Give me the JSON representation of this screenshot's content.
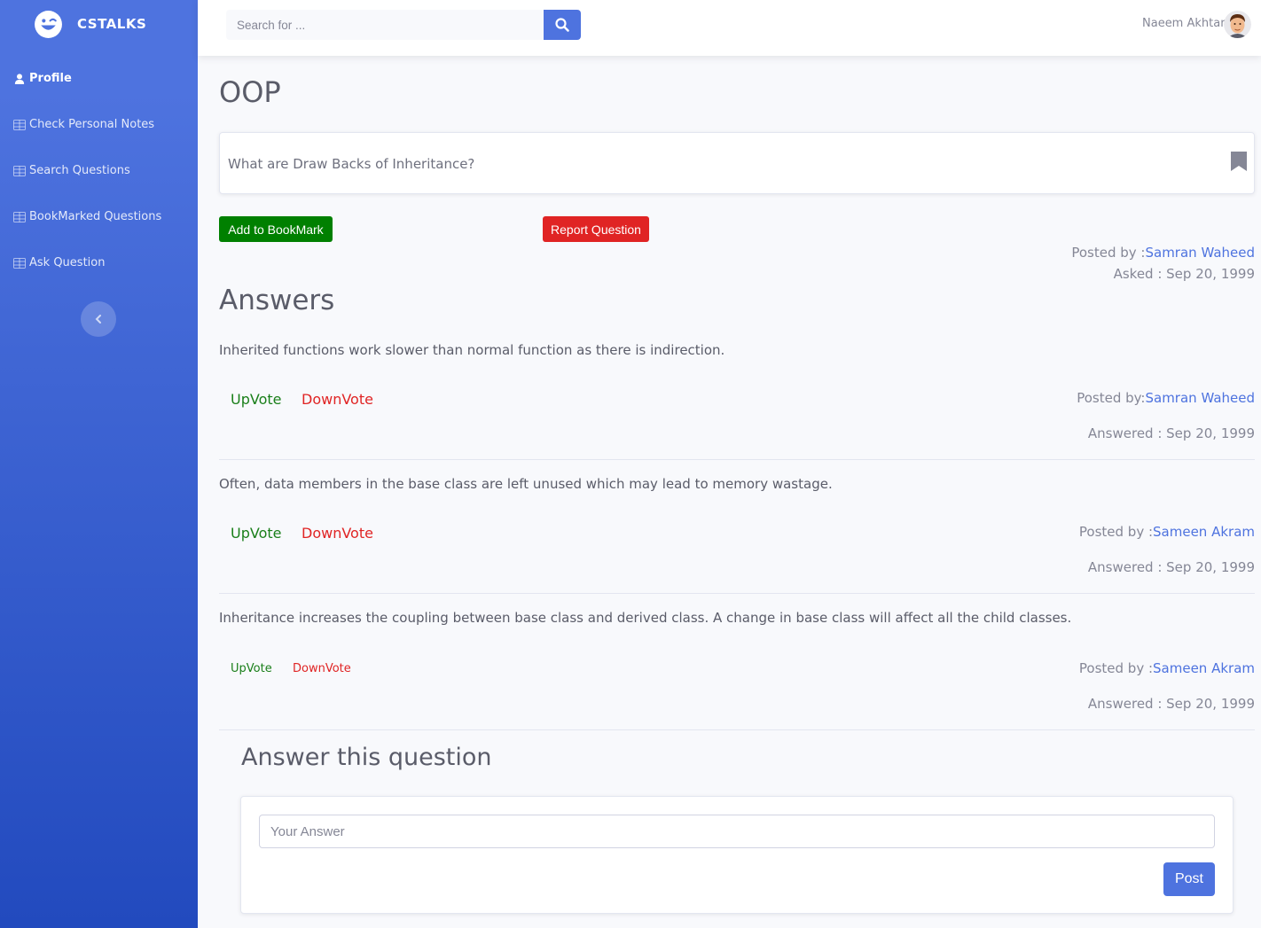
{
  "brand": {
    "name": "CSTALKS",
    "icon": "laugh-wink-icon"
  },
  "sidebar": {
    "items": [
      {
        "label": "Profile",
        "icon": "user-icon",
        "active": true
      },
      {
        "label": "Check Personal Notes",
        "icon": "table-icon"
      },
      {
        "label": "Search Questions",
        "icon": "table-icon"
      },
      {
        "label": "BookMarked Questions",
        "icon": "table-icon"
      },
      {
        "label": "Ask Question",
        "icon": "table-icon"
      }
    ],
    "toggle_icon": "chevron-left-icon"
  },
  "topbar": {
    "search_placeholder": "Search for ...",
    "search_icon": "search-icon",
    "user_name": "Naeem Akhtar"
  },
  "question": {
    "category": "OOP",
    "text": "What are Draw Backs of Inheritance?",
    "bookmark_button": "Add to BookMark",
    "report_button": "Report Question",
    "posted_by_label": "Posted by :",
    "posted_by": "Samran Waheed",
    "asked": "Asked : Sep 20, 1999"
  },
  "answers_title": "Answers",
  "answers": [
    {
      "text": "Inherited functions work slower than normal function as there is indirection.",
      "upvote": "UpVote",
      "downvote": "DownVote",
      "posted_by_label": "Posted by:",
      "posted_by": "Samran Waheed",
      "answered": "Answered : Sep 20, 1999"
    },
    {
      "text": "Often, data members in the base class are left unused which may lead to memory wastage.",
      "upvote": "UpVote",
      "downvote": "DownVote",
      "posted_by_label": "Posted by :",
      "posted_by": "Sameen Akram",
      "answered": "Answered : Sep 20, 1999"
    },
    {
      "text": "Inheritance increases the coupling between base class and derived class. A change in base class will affect all the child classes.",
      "upvote": "UpVote",
      "downvote": "DownVote",
      "posted_by_label": "Posted by :",
      "posted_by": "Sameen Akram",
      "answered": "Answered : Sep 20, 1999"
    }
  ],
  "answer_form": {
    "title": "Answer this question",
    "placeholder": "Your Answer",
    "post_button": "Post"
  },
  "colors": {
    "primary": "#4e73df",
    "success": "#008000",
    "danger": "#e02424"
  }
}
